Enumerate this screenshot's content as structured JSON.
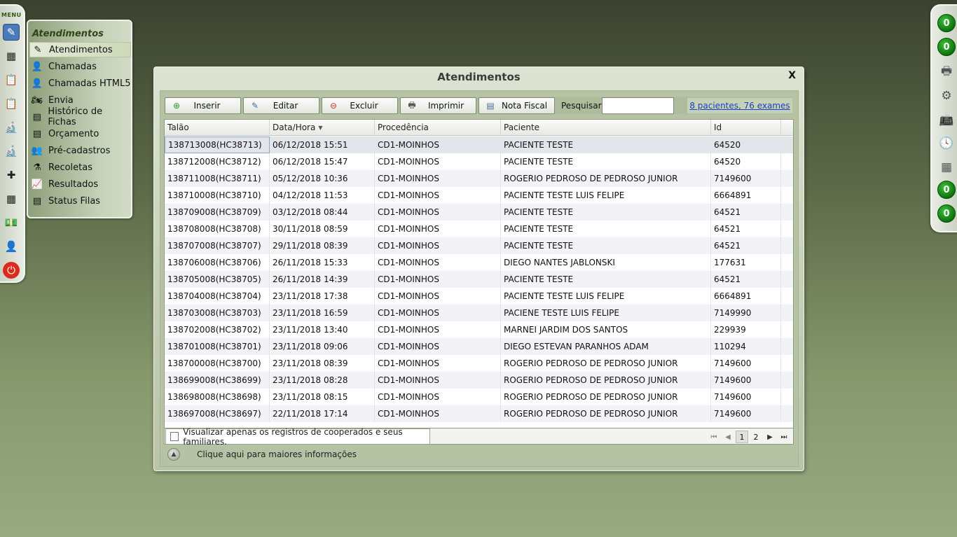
{
  "left_menu": {
    "label": "MENU",
    "icons": [
      {
        "name": "atendimentos-icon",
        "glyph": "✎",
        "active": true
      },
      {
        "name": "calendar-icon",
        "glyph": "▦"
      },
      {
        "name": "clipboard-icon",
        "glyph": "📋"
      },
      {
        "name": "clipboard-list-icon",
        "glyph": "📋"
      },
      {
        "name": "microscope-icon",
        "glyph": "🔬"
      },
      {
        "name": "microscope-2-icon",
        "glyph": "🔬"
      },
      {
        "name": "first-aid-icon",
        "glyph": "✚"
      },
      {
        "name": "calendar-grid-icon",
        "glyph": "▦"
      },
      {
        "name": "money-icon",
        "glyph": "💵"
      },
      {
        "name": "user-admin-icon",
        "glyph": "👤"
      },
      {
        "name": "power-icon",
        "glyph": "⏻"
      }
    ]
  },
  "submenu": {
    "title": "Atendimentos",
    "items": [
      {
        "label": "Atendimentos",
        "icon": "pen-icon",
        "glyph": "✎",
        "active": true
      },
      {
        "label": "Chamadas",
        "icon": "user-icon",
        "glyph": "👤"
      },
      {
        "label": "Chamadas HTML5",
        "icon": "user-icon",
        "glyph": "👤"
      },
      {
        "label": "Envia",
        "icon": "motorcycle-icon",
        "glyph": "🏍"
      },
      {
        "label": "Histórico de Fichas",
        "icon": "document-icon",
        "glyph": "▤"
      },
      {
        "label": "Orçamento",
        "icon": "document-icon",
        "glyph": "▤"
      },
      {
        "label": "Pré-cadastros",
        "icon": "people-icon",
        "glyph": "👥"
      },
      {
        "label": "Recoletas",
        "icon": "flask-icon",
        "glyph": "⚗"
      },
      {
        "label": "Resultados",
        "icon": "chart-icon",
        "glyph": "📈"
      },
      {
        "label": "Status Filas",
        "icon": "document-icon",
        "glyph": "▤"
      }
    ]
  },
  "right_bar": {
    "counter_top_1": "0",
    "counter_top_2": "0",
    "counter_bottom_1": "0",
    "counter_bottom_2": "0",
    "icons": [
      {
        "name": "printer-icon",
        "glyph": "🖶"
      },
      {
        "name": "gear-icon",
        "glyph": "⚙"
      },
      {
        "name": "fax-icon",
        "glyph": "📠"
      },
      {
        "name": "clock-icon",
        "glyph": "🕓"
      },
      {
        "name": "calculator-icon",
        "glyph": "▦"
      }
    ]
  },
  "window": {
    "title": "Atendimentos",
    "close": "X",
    "toolbar": {
      "insert_label": "Inserir",
      "edit_label": "Editar",
      "delete_label": "Excluir",
      "print_label": "Imprimir",
      "invoice_label": "Nota Fiscal",
      "search_label": "Pesquisar:",
      "search_value": "",
      "summary_link": "8 pacientes, 76 exames"
    },
    "table": {
      "columns": [
        "Talão",
        "Data/Hora",
        "Procedência",
        "Paciente",
        "Id"
      ],
      "rows": [
        [
          "138713008(HC38713)",
          "06/12/2018 15:51",
          "CD1-MOINHOS",
          "PACIENTE TESTE",
          "64520"
        ],
        [
          "138712008(HC38712)",
          "06/12/2018 15:47",
          "CD1-MOINHOS",
          "PACIENTE TESTE",
          "64520"
        ],
        [
          "138711008(HC38711)",
          "05/12/2018 10:36",
          "CD1-MOINHOS",
          "ROGERIO PEDROSO DE PEDROSO JUNIOR",
          "7149600"
        ],
        [
          "138710008(HC38710)",
          "04/12/2018 11:53",
          "CD1-MOINHOS",
          "PACIENTE TESTE LUIS FELIPE",
          "6664891"
        ],
        [
          "138709008(HC38709)",
          "03/12/2018 08:44",
          "CD1-MOINHOS",
          "PACIENTE TESTE",
          "64521"
        ],
        [
          "138708008(HC38708)",
          "30/11/2018 08:59",
          "CD1-MOINHOS",
          "PACIENTE TESTE",
          "64521"
        ],
        [
          "138707008(HC38707)",
          "29/11/2018 08:39",
          "CD1-MOINHOS",
          "PACIENTE TESTE",
          "64521"
        ],
        [
          "138706008(HC38706)",
          "26/11/2018 15:33",
          "CD1-MOINHOS",
          "DIEGO NANTES JABLONSKI",
          "177631"
        ],
        [
          "138705008(HC38705)",
          "26/11/2018 14:39",
          "CD1-MOINHOS",
          "PACIENTE TESTE",
          "64521"
        ],
        [
          "138704008(HC38704)",
          "23/11/2018 17:38",
          "CD1-MOINHOS",
          "PACIENTE TESTE LUIS FELIPE",
          "6664891"
        ],
        [
          "138703008(HC38703)",
          "23/11/2018 16:59",
          "CD1-MOINHOS",
          "PACIENE TESTE LUIS FELIPE",
          "7149990"
        ],
        [
          "138702008(HC38702)",
          "23/11/2018 13:40",
          "CD1-MOINHOS",
          "MARNEI JARDIM DOS SANTOS",
          "229939"
        ],
        [
          "138701008(HC38701)",
          "23/11/2018 09:06",
          "CD1-MOINHOS",
          "DIEGO ESTEVAN PARANHOS ADAM",
          "110294"
        ],
        [
          "138700008(HC38700)",
          "23/11/2018 08:39",
          "CD1-MOINHOS",
          "ROGERIO PEDROSO DE PEDROSO JUNIOR",
          "7149600"
        ],
        [
          "138699008(HC38699)",
          "23/11/2018 08:28",
          "CD1-MOINHOS",
          "ROGERIO PEDROSO DE PEDROSO JUNIOR",
          "7149600"
        ],
        [
          "138698008(HC38698)",
          "23/11/2018 08:15",
          "CD1-MOINHOS",
          "ROGERIO PEDROSO DE PEDROSO JUNIOR",
          "7149600"
        ],
        [
          "138697008(HC38697)",
          "22/11/2018 17:14",
          "CD1-MOINHOS",
          "ROGERIO PEDROSO DE PEDROSO JUNIOR",
          "7149600"
        ]
      ]
    },
    "footer": {
      "checkbox_label": "Visualizar apenas os registros de cooperados e seus familiares.",
      "pages": [
        "1",
        "2"
      ],
      "current_page": "1"
    },
    "info_text": "Clique aqui para maiores informações"
  }
}
